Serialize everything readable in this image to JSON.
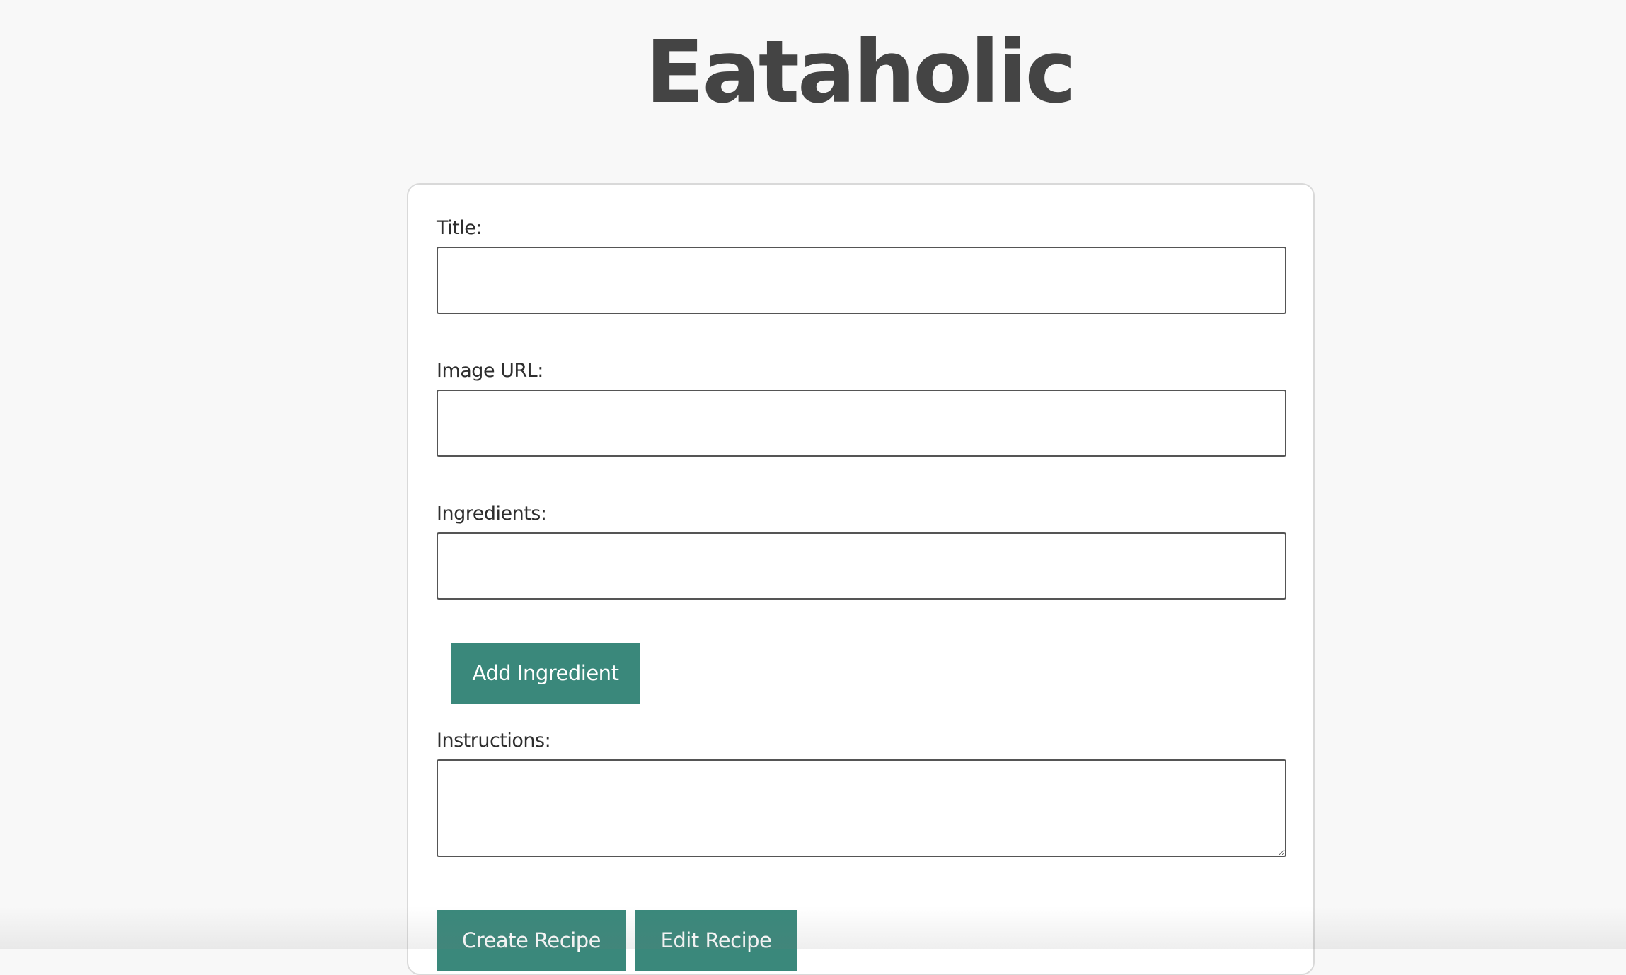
{
  "header": {
    "site_title": "Eataholic"
  },
  "form": {
    "title_label": "Title:",
    "title_value": "",
    "image_url_label": "Image URL:",
    "image_url_value": "",
    "ingredients_label": "Ingredients:",
    "ingredients_value": "",
    "add_ingredient_label": "Add Ingredient",
    "instructions_label": "Instructions:",
    "instructions_value": "",
    "create_recipe_label": "Create Recipe",
    "edit_recipe_label": "Edit Recipe"
  },
  "colors": {
    "button_teal": "#3a887b",
    "page_background": "#f8f8f8",
    "title_text": "#444444"
  }
}
